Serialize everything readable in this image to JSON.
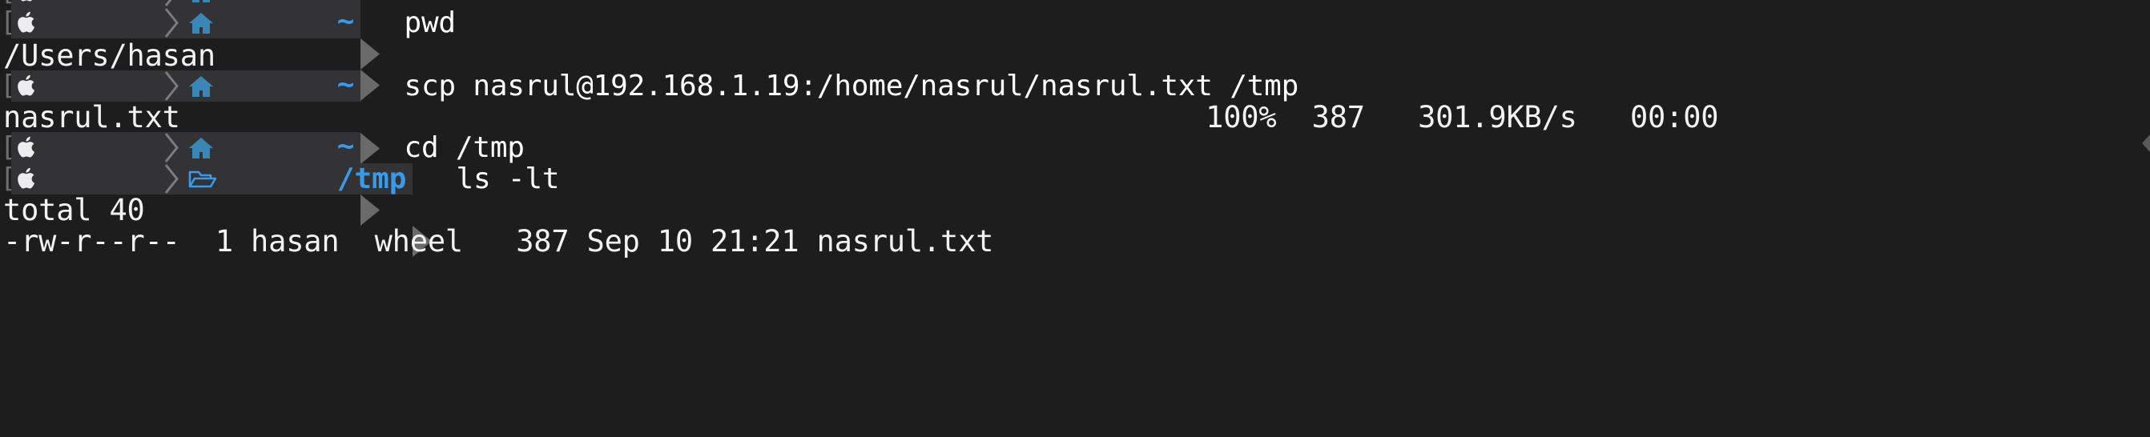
{
  "terminal": {
    "background": "#1d1d1d",
    "foreground": "#f2f2f2",
    "prompt_segment_bg": "#333335",
    "accent_blue": "#3b9ae8",
    "home_icon_blue": "#3a87b5",
    "separator_grey": "#6f6f6f",
    "title": "Terminal"
  },
  "icons": {
    "apple": "apple-logo-icon",
    "home": "home-icon",
    "folder": "open-folder-icon",
    "tilde": "~",
    "bracket": "["
  },
  "lines": [
    {
      "type": "prompt",
      "segment": "home",
      "path": "~",
      "command": "pwd"
    },
    {
      "type": "output",
      "text": "/Users/hasan"
    },
    {
      "type": "prompt",
      "segment": "home",
      "path": "~",
      "command": "scp nasrul@192.168.1.19:/home/nasrul/nasrul.txt /tmp"
    },
    {
      "type": "output",
      "text": "nasrul.txt                                                          100%  387   301.9KB/s   00:00"
    },
    {
      "type": "prompt",
      "segment": "home",
      "path": "~",
      "command": "cd /tmp"
    },
    {
      "type": "prompt",
      "segment": "folder",
      "path": "/tmp",
      "command": "ls -lt"
    },
    {
      "type": "output",
      "text": "total 40"
    },
    {
      "type": "output",
      "text": "-rw-r--r--  1 hasan  wheel   387 Sep 10 21:21 nasrul.txt"
    }
  ],
  "scp_transfer": {
    "file": "nasrul.txt",
    "percent": "100%",
    "bytes": "387",
    "rate": "301.9KB/s",
    "eta": "00:00"
  },
  "file_listing": {
    "total": "total 40",
    "entries": [
      {
        "permissions": "-rw-r--r--",
        "links": "1",
        "owner": "hasan",
        "group": "wheel",
        "size": "387",
        "month": "Sep",
        "day": "10",
        "time": "21:21",
        "name": "nasrul.txt"
      }
    ]
  }
}
